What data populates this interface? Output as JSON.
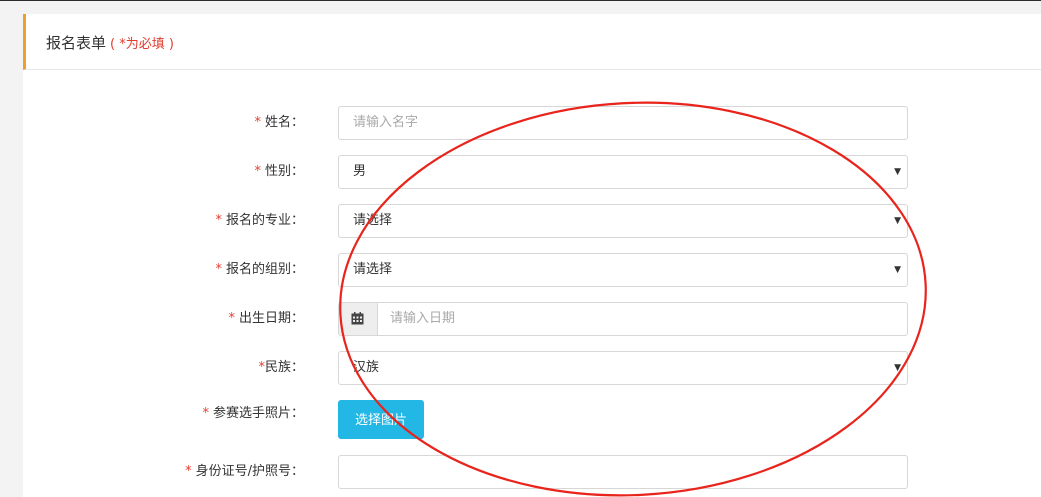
{
  "form": {
    "title": "报名表单",
    "required_note": "( *为必填 )",
    "fields": [
      {
        "label": "姓名：",
        "placeholder": "请输入名字"
      },
      {
        "label": "性别：",
        "value": "男"
      },
      {
        "label": "报名的专业：",
        "value": "请选择"
      },
      {
        "label": "报名的组别：",
        "value": "请选择"
      },
      {
        "label": "出生日期：",
        "placeholder": "请输入日期"
      },
      {
        "label": "民族：",
        "value": "汉族"
      },
      {
        "label": "参赛选手照片：",
        "button_label": "选择图片"
      },
      {
        "label": "身份证号/护照号：",
        "value": ""
      }
    ],
    "required_mark": "*"
  },
  "annotation": {
    "shape": "ellipse",
    "color": "#e8241c"
  },
  "colors": {
    "accent": "#f0a02a",
    "required": "#e43b2f",
    "button": "#23b7e5"
  },
  "icons": {
    "date": "calendar-icon",
    "select": "caret-down-icon"
  }
}
